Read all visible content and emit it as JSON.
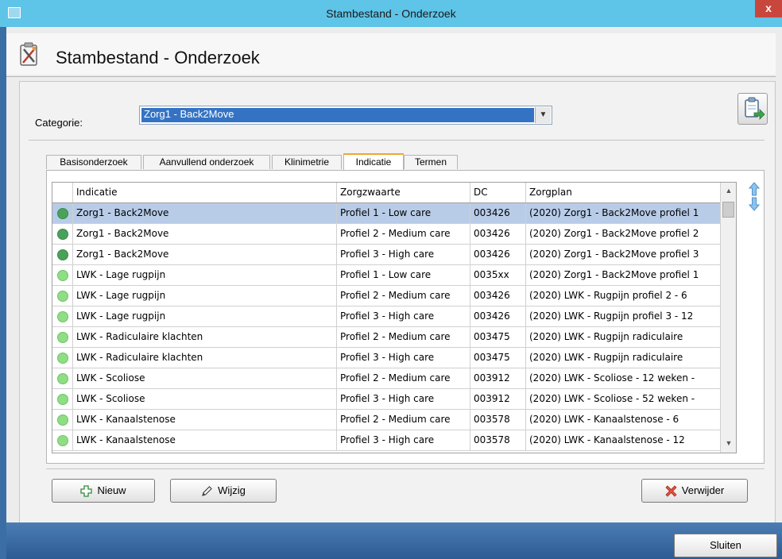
{
  "window": {
    "title": "Stambestand - Onderzoek",
    "close_glyph": "x"
  },
  "header": {
    "title": "Stambestand - Onderzoek",
    "icon": "tools-clipboard-icon"
  },
  "category": {
    "label": "Categorie:",
    "value": "Zorg1 - Back2Move"
  },
  "tabs": [
    {
      "label": "Basisonderzoek",
      "active": false
    },
    {
      "label": "Aanvullend onderzoek",
      "active": false
    },
    {
      "label": "Klinimetrie",
      "active": false
    },
    {
      "label": "Indicatie",
      "active": true
    },
    {
      "label": "Termen",
      "active": false
    }
  ],
  "table": {
    "columns": [
      "Indicatie",
      "Zorgzwaarte",
      "DC",
      "Zorgplan"
    ],
    "rows": [
      {
        "status": "dark",
        "indicatie": "Zorg1 - Back2Move",
        "zorgzwaarte": "Profiel 1 - Low care",
        "dc": "003426",
        "zorgplan": "(2020) Zorg1 - Back2Move profiel 1",
        "selected": true
      },
      {
        "status": "dark",
        "indicatie": "Zorg1 - Back2Move",
        "zorgzwaarte": "Profiel 2 - Medium care",
        "dc": "003426",
        "zorgplan": "(2020) Zorg1 - Back2Move profiel 2",
        "selected": false
      },
      {
        "status": "dark",
        "indicatie": "Zorg1 - Back2Move",
        "zorgzwaarte": "Profiel 3 - High care",
        "dc": "003426",
        "zorgplan": "(2020) Zorg1 - Back2Move profiel 3",
        "selected": false
      },
      {
        "status": "light",
        "indicatie": "LWK - Lage rugpijn",
        "zorgzwaarte": "Profiel 1 - Low care",
        "dc": "0035xx",
        "zorgplan": "(2020) Zorg1 - Back2Move profiel 1",
        "selected": false
      },
      {
        "status": "light",
        "indicatie": "LWK - Lage rugpijn",
        "zorgzwaarte": "Profiel 2 - Medium care",
        "dc": "003426",
        "zorgplan": "(2020) LWK - Rugpijn profiel 2 - 6",
        "selected": false
      },
      {
        "status": "light",
        "indicatie": "LWK - Lage rugpijn",
        "zorgzwaarte": "Profiel 3 - High care",
        "dc": "003426",
        "zorgplan": "(2020) LWK - Rugpijn profiel 3 - 12",
        "selected": false
      },
      {
        "status": "light",
        "indicatie": "LWK - Radiculaire klachten",
        "zorgzwaarte": "Profiel 2 - Medium care",
        "dc": "003475",
        "zorgplan": "(2020) LWK - Rugpijn radiculaire",
        "selected": false
      },
      {
        "status": "light",
        "indicatie": "LWK - Radiculaire klachten",
        "zorgzwaarte": "Profiel 3 - High care",
        "dc": "003475",
        "zorgplan": "(2020) LWK - Rugpijn radiculaire",
        "selected": false
      },
      {
        "status": "light",
        "indicatie": "LWK - Scoliose",
        "zorgzwaarte": "Profiel 2 - Medium care",
        "dc": "003912",
        "zorgplan": "(2020) LWK - Scoliose - 12 weken -",
        "selected": false
      },
      {
        "status": "light",
        "indicatie": "LWK - Scoliose",
        "zorgzwaarte": "Profiel 3 - High care",
        "dc": "003912",
        "zorgplan": "(2020) LWK - Scoliose - 52 weken -",
        "selected": false
      },
      {
        "status": "light",
        "indicatie": "LWK - Kanaalstenose",
        "zorgzwaarte": "Profiel 2 - Medium care",
        "dc": "003578",
        "zorgplan": "(2020) LWK - Kanaalstenose - 6",
        "selected": false
      },
      {
        "status": "light",
        "indicatie": "LWK - Kanaalstenose",
        "zorgzwaarte": "Profiel 3 - High care",
        "dc": "003578",
        "zorgplan": "(2020) LWK - Kanaalstenose - 12",
        "selected": false
      }
    ]
  },
  "buttons": {
    "new_label": "Nieuw",
    "edit_label": "Wijzig",
    "delete_label": "Verwijder",
    "close_label": "Sluiten"
  },
  "colors": {
    "titlebar": "#5ec4e8",
    "selection": "#b8cce8",
    "status_dark": "#4aa25a",
    "status_light": "#8fde86",
    "tab_accent": "#f0a531"
  }
}
